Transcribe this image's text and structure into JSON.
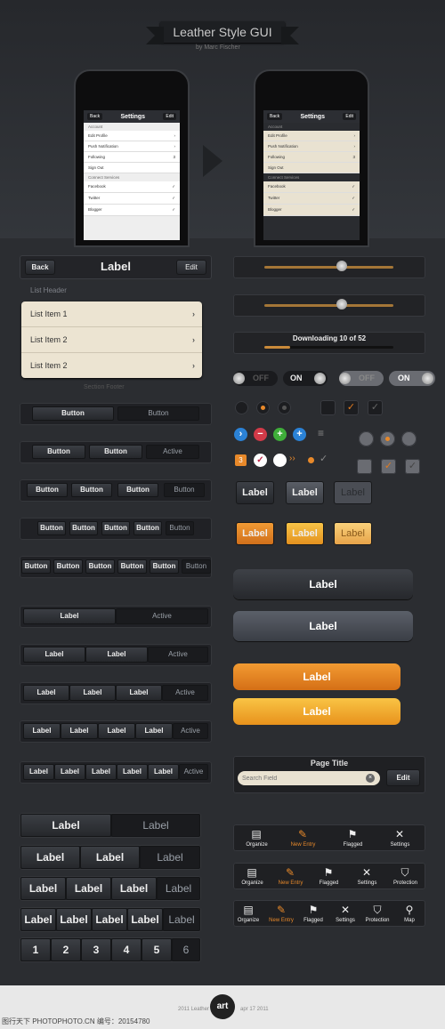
{
  "hero": {
    "title": "Leather Style GUI",
    "byline": "by Marc Fischer"
  },
  "phone1": {
    "back": "Back",
    "title": "Settings",
    "edit": "Edit",
    "sec1": "Account",
    "rows": [
      "Edit Profile",
      "Push Notification",
      "Following",
      "Sign Out"
    ],
    "badge": "3",
    "sec2": "Connect Services",
    "services": [
      "Facebook",
      "Twitter",
      "Blogger"
    ]
  },
  "phone2": {
    "back": "Back",
    "title": "Settings",
    "edit": "Edit",
    "sec1": "Account",
    "rows": [
      "Edit Profile",
      "Push Notification",
      "Following",
      "Sign Out"
    ],
    "badge": "3",
    "sec2": "Connect Services",
    "services": [
      "Facebook",
      "Twitter",
      "Blogger"
    ]
  },
  "navbar": {
    "back": "Back",
    "title": "Label",
    "edit": "Edit"
  },
  "list": {
    "header": "List Header",
    "items": [
      "List Item 1",
      "List Item 2",
      "List Item 2"
    ],
    "footer": "Section Footer"
  },
  "segs": {
    "button": "Button",
    "active": "Active",
    "label": "Label"
  },
  "download": {
    "text": "Downloading 10 of 52",
    "progress": 0.2
  },
  "sliders": [
    0.6,
    0.6
  ],
  "toggles": {
    "off": "OFF",
    "on": "ON"
  },
  "small_buttons": {
    "label": "Label"
  },
  "big_buttons": [
    "Label",
    "Label",
    "Label",
    "Label"
  ],
  "search": {
    "title": "Page Title",
    "placeholder": "Search Field",
    "edit": "Edit"
  },
  "tabs": {
    "organize": "Organize",
    "new_entry": "New Entry",
    "flagged": "Flagged",
    "settings": "Settings",
    "protection": "Protection",
    "map": "Map"
  },
  "pager": [
    "1",
    "2",
    "3",
    "4",
    "5",
    "6"
  ],
  "badge_num": "3",
  "footer": {
    "left": "图行天下 PHOTOPHOTO.CN  编号：20154780",
    "mid": "2011 Leather",
    "right": "apr 17 2011"
  },
  "colors": {
    "orange": "#e8892a",
    "leather": "#ece4d2",
    "bg": "#2b2d31"
  }
}
